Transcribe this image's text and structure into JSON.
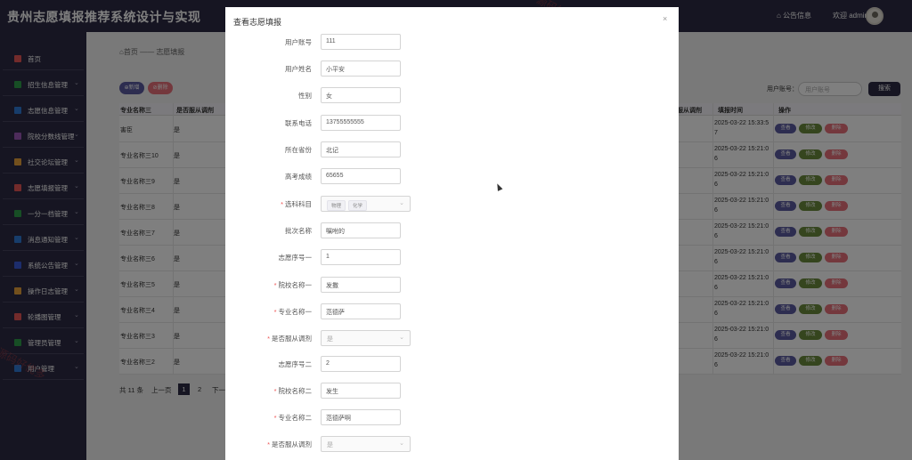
{
  "header": {
    "app_title": "贵州志愿填报推荐系统设计与实现",
    "notice_label": "公告信息",
    "welcome_text": "欢迎 admin"
  },
  "sidebar": {
    "items": [
      {
        "label": "首页",
        "color": "#e65757"
      },
      {
        "label": "招生信息管理",
        "color": "#2e9d4a"
      },
      {
        "label": "志愿信息管理",
        "color": "#2f7ad6"
      },
      {
        "label": "院校分数线管理",
        "color": "#9b59b6"
      },
      {
        "label": "社交论坛管理",
        "color": "#e6a13b"
      },
      {
        "label": "志愿填报管理",
        "color": "#e65757"
      },
      {
        "label": "一分一档管理",
        "color": "#2e9d4a"
      },
      {
        "label": "消息通知管理",
        "color": "#2f7ad6"
      },
      {
        "label": "系统公告管理",
        "color": "#3b5bd9"
      },
      {
        "label": "操作日志管理",
        "color": "#e6a13b"
      },
      {
        "label": "轮播图管理",
        "color": "#e65757"
      },
      {
        "label": "管理员管理",
        "color": "#2e9d4a"
      },
      {
        "label": "用户管理",
        "color": "#2f7ad6"
      }
    ]
  },
  "breadcrumb": {
    "home": "首页",
    "sep": "——",
    "current": "志愿填报"
  },
  "toolbar": {
    "add_label": "新增",
    "delete_label": "删除"
  },
  "search": {
    "label": "用户账号：",
    "placeholder": "用户账号",
    "button_label": "搜索"
  },
  "table": {
    "headers": {
      "col1": "专业名称三",
      "col2": "是否服从调剂",
      "col3": "服从调剂",
      "col4": "填报时间",
      "col5": "操作"
    },
    "rows": [
      {
        "name": "害臣",
        "adjust": "是",
        "time": "2025-03-22 15:33:5",
        "time2": "7"
      },
      {
        "name": "专业名称三10",
        "adjust": "是",
        "time": "2025-03-22 15:21:0",
        "time2": "6"
      },
      {
        "name": "专业名称三9",
        "adjust": "是",
        "time": "2025-03-22 15:21:0",
        "time2": "6"
      },
      {
        "name": "专业名称三8",
        "adjust": "是",
        "time": "2025-03-22 15:21:0",
        "time2": "6"
      },
      {
        "name": "专业名称三7",
        "adjust": "是",
        "time": "2025-03-22 15:21:0",
        "time2": "6"
      },
      {
        "name": "专业名称三6",
        "adjust": "是",
        "time": "2025-03-22 15:21:0",
        "time2": "6"
      },
      {
        "name": "专业名称三5",
        "adjust": "是",
        "time": "2025-03-22 15:21:0",
        "time2": "6"
      },
      {
        "name": "专业名称三4",
        "adjust": "是",
        "time": "2025-03-22 15:21:0",
        "time2": "6"
      },
      {
        "name": "专业名称三3",
        "adjust": "是",
        "time": "2025-03-22 15:21:0",
        "time2": "6"
      },
      {
        "name": "专业名称三2",
        "adjust": "是",
        "time": "2025-03-22 15:21:0",
        "time2": "6"
      }
    ],
    "ops": {
      "view": "查看",
      "edit": "修改",
      "remove": "删除"
    }
  },
  "pager": {
    "total": "共 11 条",
    "prev": "上一页",
    "page1": "1",
    "page2": "2",
    "next": "下一"
  },
  "watermark": "源码好优多",
  "dialog": {
    "title": "查看志愿填报",
    "close": "×",
    "fields": [
      {
        "label": "用户账号",
        "required": false,
        "value": "111"
      },
      {
        "label": "用户姓名",
        "required": false,
        "value": "小平安"
      },
      {
        "label": "性别",
        "required": false,
        "value": "女"
      },
      {
        "label": "联系电话",
        "required": false,
        "value": "13755555555"
      },
      {
        "label": "所在省份",
        "required": false,
        "value": "北记"
      },
      {
        "label": "高考成绩",
        "required": false,
        "value": "65655"
      },
      {
        "label": "选科科目",
        "required": true,
        "tags": [
          "物理",
          "化学"
        ]
      },
      {
        "label": "批次名称",
        "required": false,
        "value": "嘱咐的"
      },
      {
        "label": "志愿序号一",
        "required": false,
        "value": "1"
      },
      {
        "label": "院校名称一",
        "required": true,
        "value": "发撒"
      },
      {
        "label": "专业名称一",
        "required": true,
        "value": "范德萨"
      },
      {
        "label": "是否服从调剂",
        "required": true,
        "select": "是"
      },
      {
        "label": "志愿序号二",
        "required": false,
        "value": "2"
      },
      {
        "label": "院校名称二",
        "required": true,
        "value": "发生"
      },
      {
        "label": "专业名称二",
        "required": true,
        "value": "范德萨啊"
      },
      {
        "label": "是否服从调剂",
        "required": true,
        "select": "是"
      }
    ]
  }
}
